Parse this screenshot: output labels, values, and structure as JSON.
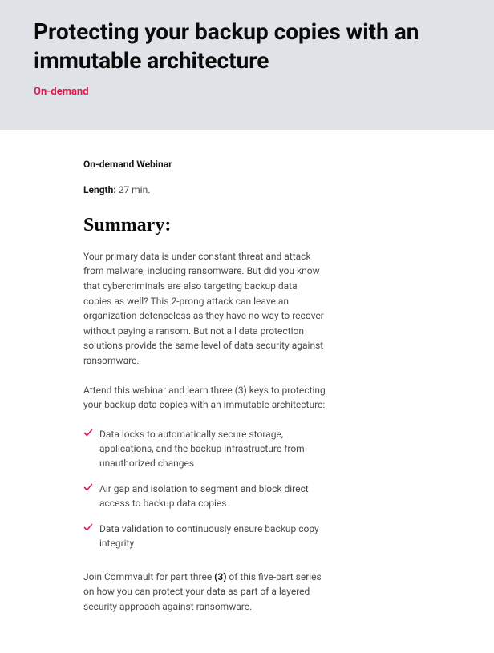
{
  "hero": {
    "title": "Protecting your backup copies with an immutable architecture",
    "tag": "On-demand"
  },
  "content": {
    "type_label": "On-demand Webinar",
    "length_label": "Length:",
    "length_value": " 27 min.",
    "summary_heading": "Summary:",
    "para1": "Your primary data is under constant threat and attack from malware, including ransomware. But did you know that cybercriminals are also targeting backup data copies as well? This 2-prong attack can leave an organization defenseless as they have no way to recover without paying a ransom. But not all data protection solutions provide the same level of data security against ransomware.",
    "para2": "Attend this webinar and learn three (3) keys to protecting your backup data copies with an immutable architecture:",
    "bullets": [
      "Data locks to automatically secure storage, applications, and the backup infrastructure from unauthorized changes",
      "Air gap and isolation to segment and block direct access to backup data copies",
      "Data validation to continuously ensure backup copy integrity"
    ],
    "closing_prefix": "Join Commvault for part three ",
    "closing_bold": "(3)",
    "closing_suffix": " of this five-part series on how you can protect your data as part of a layered security approach against ransomware."
  },
  "colors": {
    "accent": "#e6174c"
  }
}
